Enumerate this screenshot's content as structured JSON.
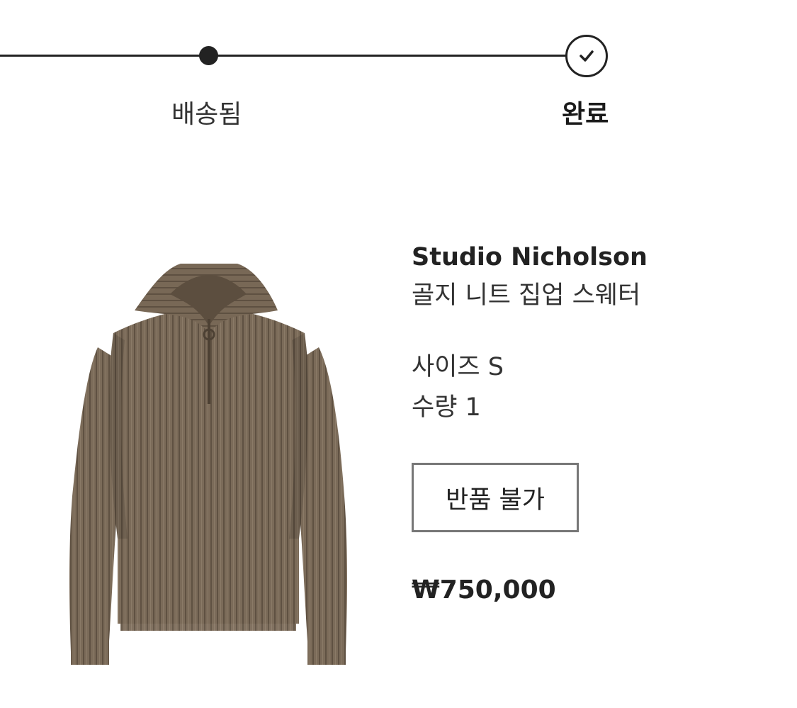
{
  "progress": {
    "steps": [
      {
        "label": "배송됨",
        "state": "reached"
      },
      {
        "label": "완료",
        "state": "current-completed"
      }
    ]
  },
  "product": {
    "image_alt": "sweater-product-image",
    "brand": "Studio Nicholson",
    "name": "골지 니트 집업 스웨터",
    "size_label": "사이즈",
    "size_value": "S",
    "quantity_label": "수량",
    "quantity_value": "1",
    "return_status": "반품 불가",
    "price": "₩750,000"
  },
  "colors": {
    "ink": "#222222",
    "sweater": "#7a6a58",
    "border": "#777777"
  },
  "icons": {
    "step_complete": "check-circle-icon",
    "step_shipped": "filled-dot-icon"
  }
}
